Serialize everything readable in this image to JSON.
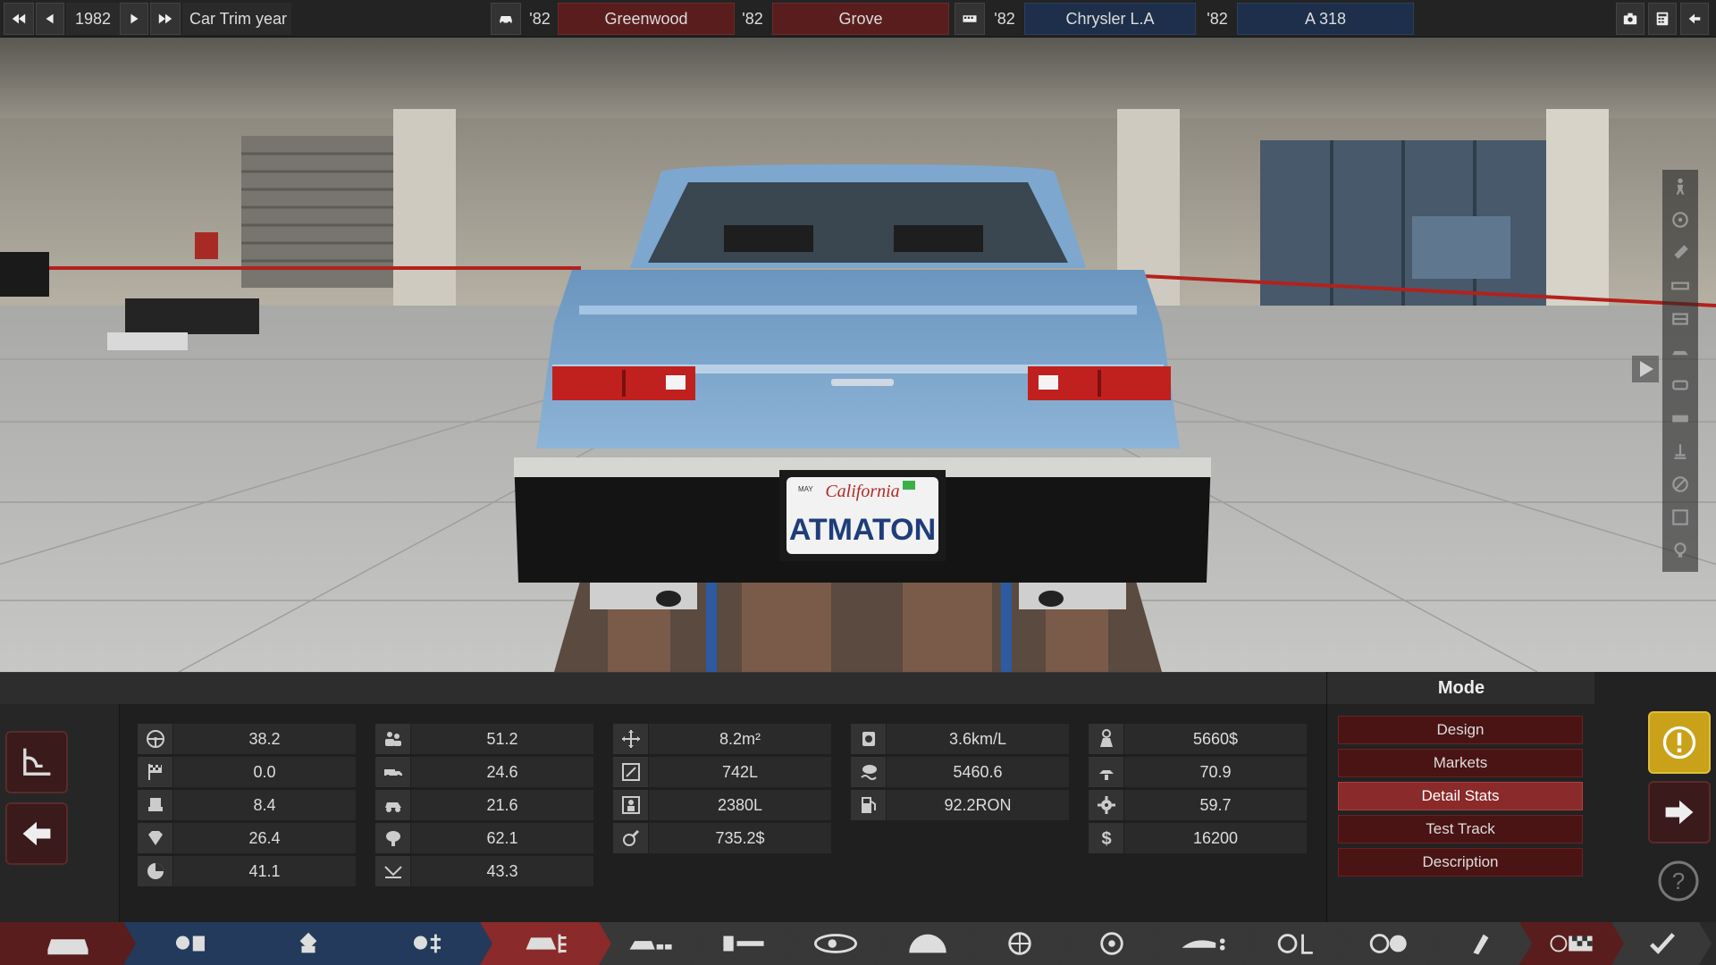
{
  "topbar": {
    "year": "1982",
    "year_label": "Car Trim year",
    "model_year": "'82",
    "model_name": "Greenwood",
    "trim_year": "'82",
    "trim_name": "Grove",
    "engine_family_year": "'82",
    "engine_family_name": "Chrysler L.A",
    "engine_variant_year": "'82",
    "engine_variant_name": "A 318"
  },
  "stats": {
    "col1": [
      "38.2",
      "0.0",
      "8.4",
      "26.4",
      "41.1"
    ],
    "col2": [
      "51.2",
      "24.6",
      "21.6",
      "62.1",
      "43.3"
    ],
    "col3": [
      "8.2m²",
      "742L",
      "2380L",
      "735.2$"
    ],
    "col4": [
      "3.6km/L",
      "5460.6",
      "92.2RON"
    ],
    "col5": [
      "5660$",
      "70.9",
      "59.7",
      "16200"
    ]
  },
  "icons": {
    "col1": [
      "steering-wheel-icon",
      "checkered-flag-icon",
      "seat-icon",
      "gem-icon",
      "pie-chart-icon"
    ],
    "col2": [
      "passengers-icon",
      "utility-truck-icon",
      "offroad-car-icon",
      "brain-icon",
      "reliability-icon"
    ],
    "col3": [
      "move-arrows-icon",
      "cargo-volume-icon",
      "passenger-volume-icon",
      "repair-cost-icon"
    ],
    "col4": [
      "fuel-economy-icon",
      "emissions-icon",
      "fuel-pump-icon"
    ],
    "col5": [
      "material-cost-icon",
      "engineering-icon",
      "manufacturing-icon",
      "dollar-icon"
    ]
  },
  "mode": {
    "title": "Mode",
    "items": [
      "Design",
      "Markets",
      "Detail Stats",
      "Test Track",
      "Description"
    ],
    "active_index": 2
  },
  "scene": {
    "plate_state": "California",
    "plate_text": "ATMATON",
    "plate_month": "MAY"
  },
  "colors": {
    "accent_red": "#8a2a2a",
    "car_blue": "#7fa6c9",
    "warning_yellow": "#c9a21a"
  }
}
